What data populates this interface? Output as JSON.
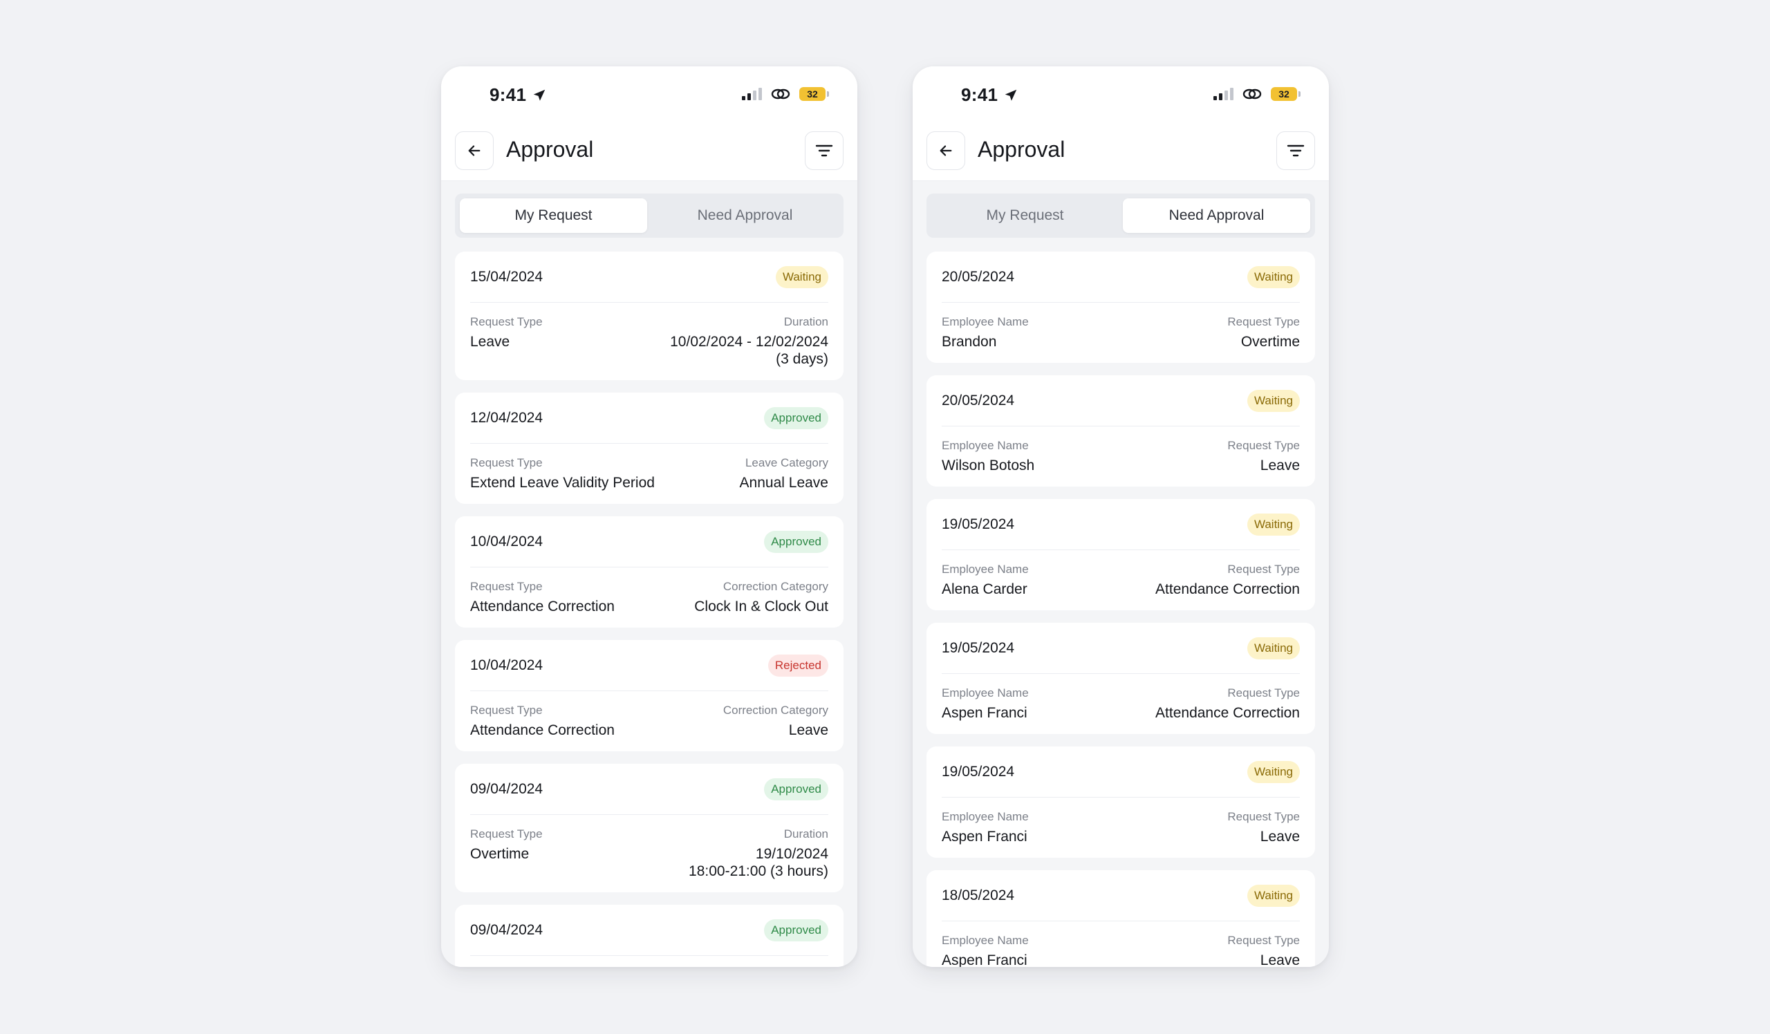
{
  "left_phone": {
    "status": {
      "time": "9:41",
      "battery": "32"
    },
    "header": {
      "title": "Approval"
    },
    "tabs": [
      {
        "label": "My Request",
        "active": true
      },
      {
        "label": "Need Approval",
        "active": false
      }
    ],
    "cards": [
      {
        "date": "15/04/2024",
        "status": "Waiting",
        "left_label": "Request Type",
        "left_value": "Leave",
        "right_label": "Duration",
        "right_value": "10/02/2024 - 12/02/2024\n(3 days)"
      },
      {
        "date": "12/04/2024",
        "status": "Approved",
        "left_label": "Request Type",
        "left_value": "Extend Leave Validity Period",
        "right_label": "Leave Category",
        "right_value": "Annual Leave"
      },
      {
        "date": "10/04/2024",
        "status": "Approved",
        "left_label": "Request Type",
        "left_value": "Attendance Correction",
        "right_label": "Correction Category",
        "right_value": "Clock In & Clock Out"
      },
      {
        "date": "10/04/2024",
        "status": "Rejected",
        "left_label": "Request Type",
        "left_value": "Attendance Correction",
        "right_label": "Correction Category",
        "right_value": "Leave"
      },
      {
        "date": "09/04/2024",
        "status": "Approved",
        "left_label": "Request Type",
        "left_value": "Overtime",
        "right_label": "Duration",
        "right_value": "19/10/2024\n18:00-21:00 (3 hours)"
      },
      {
        "date": "09/04/2024",
        "status": "Approved",
        "left_label": "",
        "left_value": "",
        "right_label": "",
        "right_value": ""
      }
    ]
  },
  "right_phone": {
    "status": {
      "time": "9:41",
      "battery": "32"
    },
    "header": {
      "title": "Approval"
    },
    "tabs": [
      {
        "label": "My Request",
        "active": false
      },
      {
        "label": "Need Approval",
        "active": true
      }
    ],
    "cards": [
      {
        "date": "20/05/2024",
        "status": "Waiting",
        "left_label": "Employee Name",
        "left_value": "Brandon",
        "right_label": "Request Type",
        "right_value": "Overtime"
      },
      {
        "date": "20/05/2024",
        "status": "Waiting",
        "left_label": "Employee Name",
        "left_value": "Wilson Botosh",
        "right_label": "Request Type",
        "right_value": "Leave"
      },
      {
        "date": "19/05/2024",
        "status": "Waiting",
        "left_label": "Employee Name",
        "left_value": "Alena Carder",
        "right_label": "Request Type",
        "right_value": "Attendance Correction"
      },
      {
        "date": "19/05/2024",
        "status": "Waiting",
        "left_label": "Employee Name",
        "left_value": "Aspen Franci",
        "right_label": "Request Type",
        "right_value": "Attendance Correction"
      },
      {
        "date": "19/05/2024",
        "status": "Waiting",
        "left_label": "Employee Name",
        "left_value": "Aspen Franci",
        "right_label": "Request Type",
        "right_value": "Leave"
      },
      {
        "date": "18/05/2024",
        "status": "Waiting",
        "left_label": "Employee Name",
        "left_value": "Aspen Franci",
        "right_label": "Request Type",
        "right_value": "Leave"
      }
    ]
  },
  "colors": {
    "waiting_bg": "#fdf3c9",
    "waiting_text": "#8a6a06",
    "approved_bg": "#e3f5e8",
    "approved_text": "#2f8a48",
    "rejected_bg": "#fde7e6",
    "rejected_text": "#c7352f",
    "battery": "#f2c132"
  }
}
